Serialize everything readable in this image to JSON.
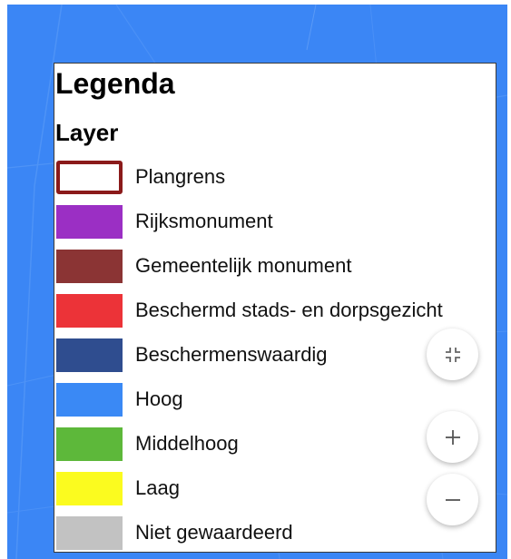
{
  "legend": {
    "title": "Legenda",
    "subtitle": "Layer",
    "items": [
      {
        "label": "Plangrens",
        "color": "#8b1a1a",
        "style": "outline"
      },
      {
        "label": "Rijksmonument",
        "color": "#9b2fc4",
        "style": "fill"
      },
      {
        "label": "Gemeentelijk monument",
        "color": "#8b3434",
        "style": "fill"
      },
      {
        "label": "Beschermd stads- en dorpsgezicht",
        "color": "#ec3338",
        "style": "fill"
      },
      {
        "label": "Beschermenswaardig",
        "color": "#2f4d8f",
        "style": "fill"
      },
      {
        "label": "Hoog",
        "color": "#3a89f5",
        "style": "fill"
      },
      {
        "label": "Middelhoog",
        "color": "#5db83a",
        "style": "fill"
      },
      {
        "label": "Laag",
        "color": "#fbfb1f",
        "style": "fill"
      },
      {
        "label": "Niet gewaardeerd",
        "color": "#c2c2c2",
        "style": "fill"
      }
    ]
  },
  "controls": {
    "collapse_icon": "collapse-arrows-icon",
    "zoom_in_icon": "plus-icon",
    "zoom_out_icon": "minus-icon"
  },
  "map": {
    "background_color": "#3b86f5"
  }
}
